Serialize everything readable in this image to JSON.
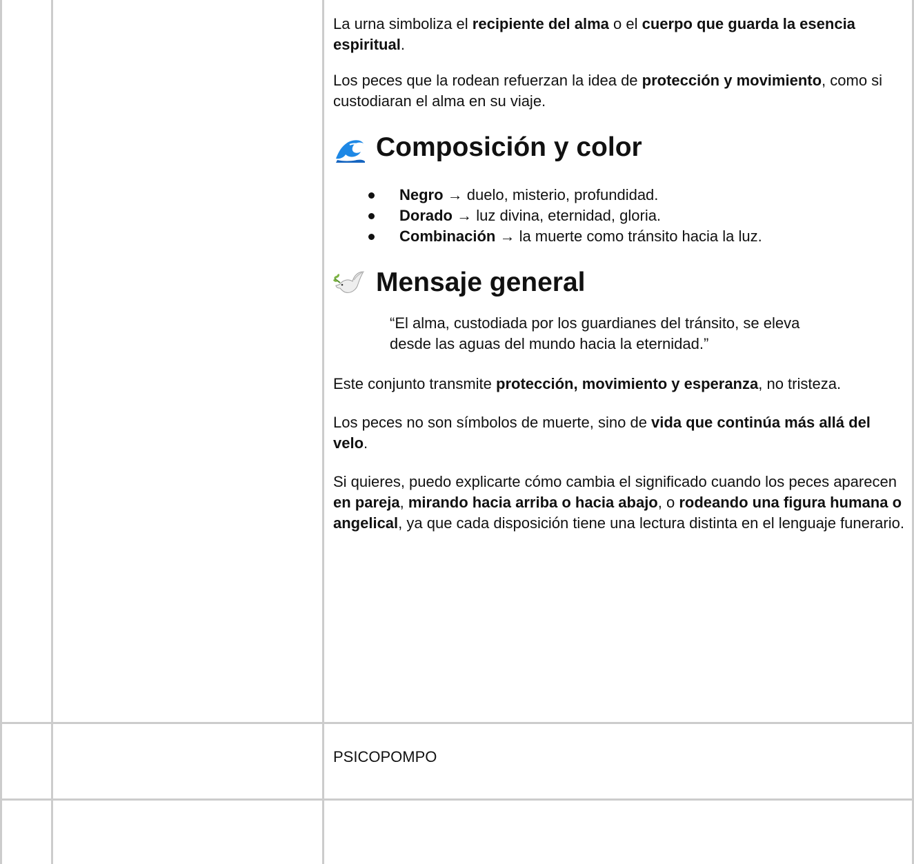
{
  "doc": {
    "para1": {
      "t1": "La urna simboliza el ",
      "b1": "recipiente del alma",
      "t2": " o el ",
      "b2": "cuerpo que guarda la esencia espiritual",
      "t3": "."
    },
    "para2": {
      "t1": "Los peces que la rodean refuerzan la idea de ",
      "b1": "protección y movimiento",
      "t2": ", como si custodiaran el alma en su viaje."
    },
    "heading1": {
      "icon": "water-wave-icon",
      "text": "Composición y color"
    },
    "bullets": [
      {
        "bold": "Negro",
        "text": " → duelo, misterio, profundidad."
      },
      {
        "bold": "Dorado",
        "text": " → luz divina, eternidad, gloria."
      },
      {
        "bold": "Combinación",
        "text": " → la muerte como tránsito hacia la luz."
      }
    ],
    "heading2": {
      "icon": "dove-icon",
      "text": "Mensaje general"
    },
    "quote": "“El alma, custodiada por los guardianes del tránsito, se eleva desde las aguas del mundo hacia la eternidad.”",
    "para3": {
      "t1": "Este conjunto transmite ",
      "b1": "protección, movimiento y esperanza",
      "t2": ", no tristeza."
    },
    "para4": {
      "t1": "Los peces no son símbolos de muerte, sino de ",
      "b1": "vida que continúa más allá del velo",
      "t2": "."
    },
    "para5": {
      "t1": "Si quieres, puedo explicarte cómo cambia el significado cuando los peces aparecen ",
      "b1": "en pareja",
      "t2": ", ",
      "b2": "mirando hacia arriba o hacia abajo",
      "t3": ", o ",
      "b3": "rodeando una figura humana o angelical",
      "t4": ", ya que cada disposición tiene una lectura distinta en el lenguaje funerario."
    }
  },
  "row2": {
    "label": "PSICOPOMPO"
  },
  "colors": {
    "gridline": "#cccccc",
    "text": "#111111",
    "wave": "#1e88e5",
    "dove": "#f0f0f0",
    "olive": "#7cb342"
  }
}
